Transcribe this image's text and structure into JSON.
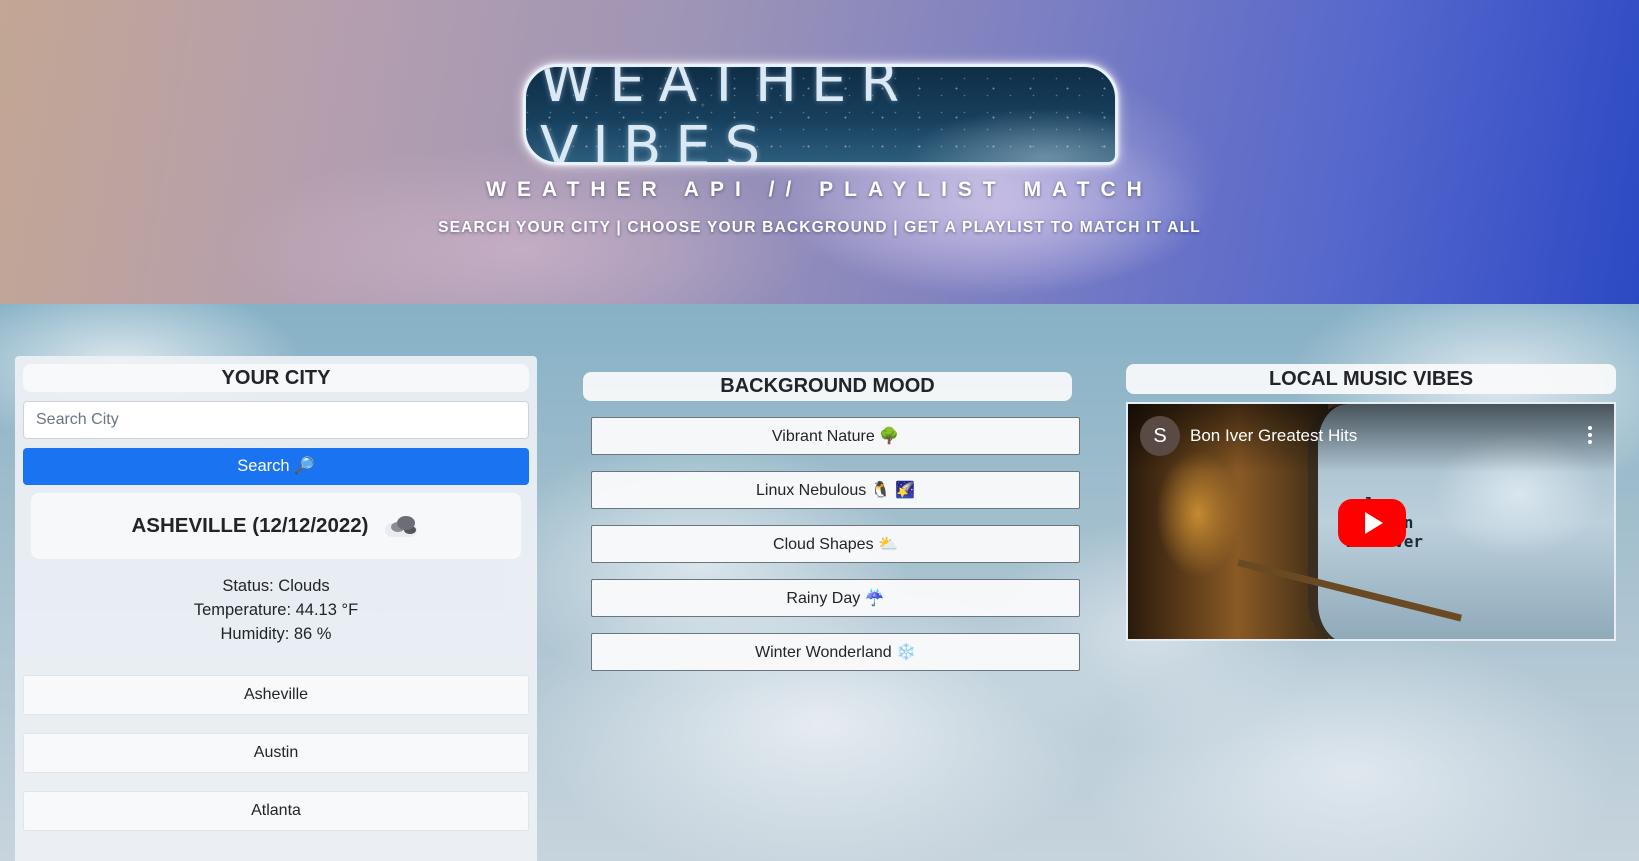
{
  "header": {
    "title": "WEATHER VIBES",
    "subtitle": "WEATHER API // PLAYLIST MATCH",
    "tagline": "SEARCH YOUR CITY | CHOOSE YOUR BACKGROUND | GET A PLAYLIST TO MATCH IT ALL"
  },
  "city_panel": {
    "heading": "YOUR CITY",
    "search_placeholder": "Search City",
    "search_value": "",
    "search_button": "Search 🔎",
    "current": {
      "city_date": "ASHEVILLE (12/12/2022)",
      "icon": "cloud-icon",
      "status": "Status: Clouds",
      "temperature": "Temperature: 44.13 °F",
      "humidity": "Humidity: 86 %"
    },
    "history": [
      "Asheville",
      "Austin",
      "Atlanta"
    ]
  },
  "mood_panel": {
    "heading": "BACKGROUND MOOD",
    "options": [
      "Vibrant Nature 🌳",
      "Linux Nebulous 🐧 🌠",
      "Cloud Shapes ⛅",
      "Rainy Day ☔",
      "Winter Wonderland ❄️"
    ]
  },
  "music_panel": {
    "heading": "LOCAL MUSIC VIBES",
    "video": {
      "channel_initial": "S",
      "title": "Bon Iver Greatest Hits",
      "overlay_text": "  le\nMillion\nBon Iver"
    }
  },
  "colors": {
    "search_button": "#1a73f0",
    "youtube_red": "#ff0000"
  }
}
